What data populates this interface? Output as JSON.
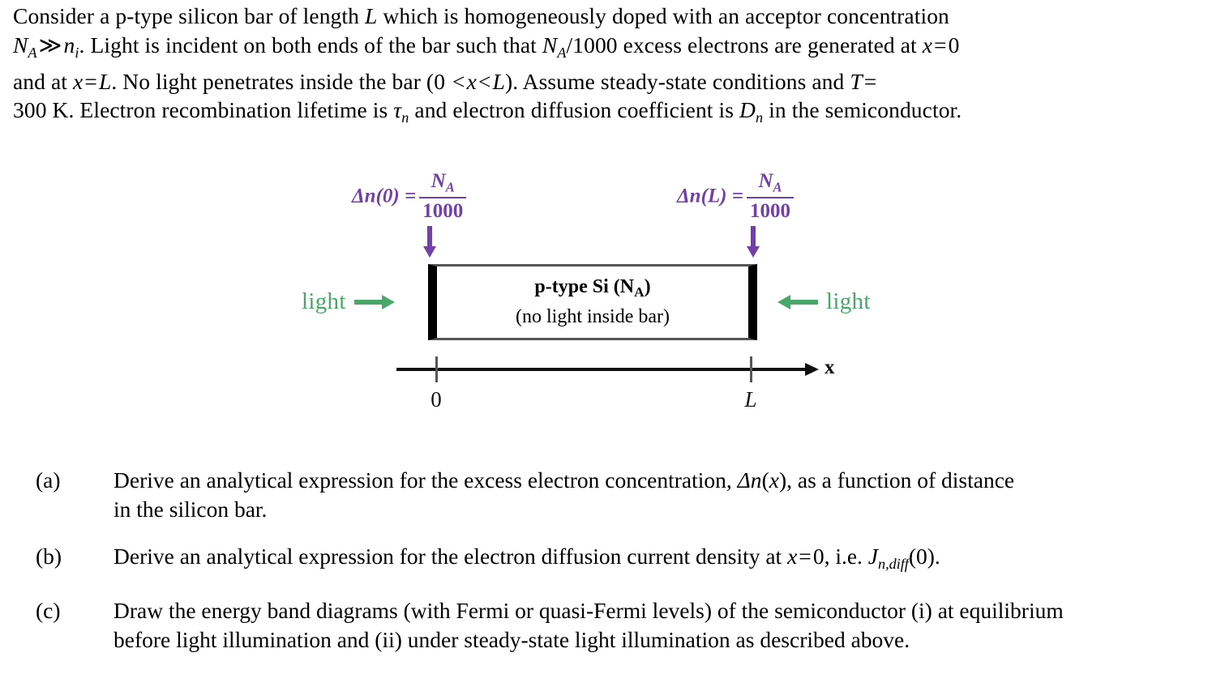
{
  "document": {
    "type": "physics-problem",
    "intro_lines": [
      "Consider a p-type silicon bar of length L which is homogeneously doped with an acceptor concentration",
      "NA ≫ ni. Light is incident on both ends of the bar such that NA/1000 excess electrons are generated at x = 0",
      "and at x = L. No light penetrates inside the bar (0 < x < L). Assume steady-state conditions and T =",
      "300 K. Electron recombination lifetime is τn and electron diffusion coefficient is Dn in the semiconductor."
    ]
  },
  "intro": {
    "l1_a": "Consider a p-type silicon bar of length ",
    "l1_L": "L",
    "l1_b": " which is homogeneously doped with an acceptor concentration",
    "l2_N": "N",
    "l2_Nsub": "A",
    "l2_gg": "≫",
    "l2_n": "n",
    "l2_nsub": "i",
    "l2_a": ". Light is incident on both ends of the bar such that ",
    "l2_N2": "N",
    "l2_N2sub": "A",
    "l2_frac": "/1000",
    "l2_b": " excess electrons are generated at ",
    "l2_x": "x",
    "l2_eq": "=",
    "l2_zero": "0",
    "l3_a": "and at ",
    "l3_x": "x",
    "l3_eq": "=",
    "l3_L": "L",
    "l3_b": ". No light penetrates inside the bar (0 ",
    "l3_lt1": "<",
    "l3_x2": "x",
    "l3_lt2": "<",
    "l3_L2": "L",
    "l3_c": "). Assume steady-state conditions and ",
    "l3_T": "T",
    "l3_eq2": "=",
    "l4_a": "300 K. Electron recombination lifetime is ",
    "l4_tau": "τ",
    "l4_tausub": "n",
    "l4_b": " and electron diffusion coefficient is ",
    "l4_D": "D",
    "l4_Dsub": "n",
    "l4_c": " in the semiconductor."
  },
  "figure": {
    "left_formula": {
      "lhs": "Δn(0) =",
      "numerator": "N",
      "numerator_sub": "A",
      "denominator": "1000"
    },
    "right_formula": {
      "lhs": "Δn(L) =",
      "numerator": "N",
      "numerator_sub": "A",
      "denominator": "1000"
    },
    "bar": {
      "line1_main": "p-type Si (N",
      "line1_sub": "A",
      "line1_end": ")",
      "line2": "(no light inside bar)"
    },
    "light_left": "light",
    "light_right": "light",
    "axis": {
      "x_label": "x",
      "tick_0": "0",
      "tick_L": "L"
    },
    "colors": {
      "annotation_purple": "#7241a8",
      "light_green": "#4aa76a",
      "bar_border": "#000000",
      "axis": "#111111"
    }
  },
  "questions": [
    {
      "marker": "(a)",
      "lines": [
        "Derive an analytical expression for the excess electron concentration, Δn(x), as a function of distance",
        "in the silicon bar."
      ],
      "line1_pre": "Derive an analytical expression for the excess electron concentration, ",
      "line1_math_a": "Δn",
      "line1_math_b": "(",
      "line1_math_x": "x",
      "line1_math_c": ")",
      "line1_post": ", as a function of distance",
      "line2": "in the silicon bar."
    },
    {
      "marker": "(b)",
      "lines": [
        "Derive an analytical expression for the electron diffusion current density at x = 0, i.e. Jn,diff(0)."
      ],
      "line1_pre": "Derive an analytical expression for the electron diffusion current density at ",
      "line1_x": "x",
      "line1_eq": "=",
      "line1_zero": "0",
      "line1_mid": ", i.e. ",
      "line1_J": "J",
      "line1_Jsub": "n,diff",
      "line1_end": "(0)."
    },
    {
      "marker": "(c)",
      "lines": [
        "Draw the energy band diagrams (with Fermi or quasi-Fermi levels) of the semiconductor (i) at equilibrium",
        "before light illumination and (ii) under steady-state light illumination as described above."
      ],
      "line1": "Draw the energy band diagrams (with Fermi or quasi-Fermi levels) of the semiconductor (i) at equilibrium",
      "line2": "before light illumination and (ii) under steady-state light illumination as described above."
    }
  ]
}
